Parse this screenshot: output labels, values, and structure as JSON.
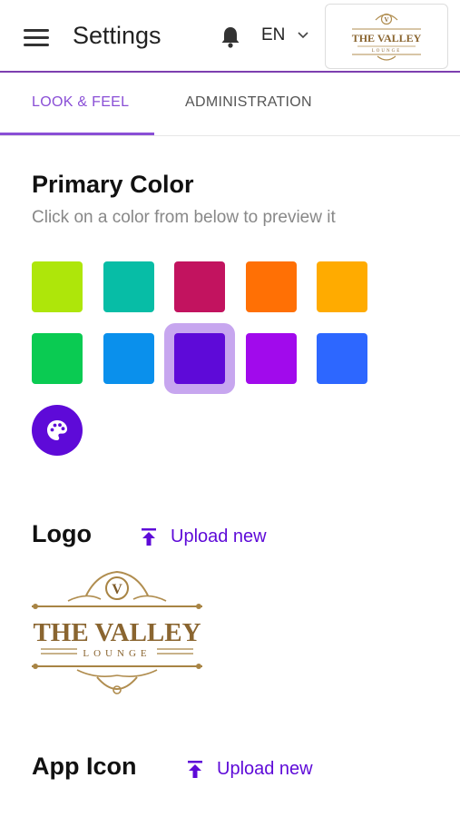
{
  "header": {
    "title": "Settings",
    "language": "EN",
    "logo": {
      "line1": "THE VALLEY",
      "line2": "LOUNGE",
      "monogram": "V"
    }
  },
  "tabs": [
    {
      "label": "LOOK & FEEL",
      "active": true
    },
    {
      "label": "ADMINISTRATION",
      "active": false
    }
  ],
  "primary_color": {
    "title": "Primary Color",
    "subtitle": "Click on a color from below to preview it",
    "swatches": [
      {
        "color": "#aee60a"
      },
      {
        "color": "#07bda6"
      },
      {
        "color": "#c2135f"
      },
      {
        "color": "#ff7005"
      },
      {
        "color": "#ffab00"
      },
      {
        "color": "#0acb52"
      },
      {
        "color": "#0a90ec"
      },
      {
        "color": "#5e0ad8",
        "selected": true
      },
      {
        "color": "#a10aec"
      },
      {
        "color": "#2d67ff"
      }
    ],
    "palette_icon": "palette-icon"
  },
  "logo_section": {
    "title": "Logo",
    "upload_label": "Upload new",
    "logo": {
      "line1": "THE VALLEY",
      "line2": "LOUNGE",
      "monogram": "V"
    }
  },
  "app_icon_section": {
    "title": "App Icon",
    "upload_label": "Upload new"
  },
  "colors": {
    "accent": "#8a4fd6",
    "primary": "#5e0ad8",
    "gold": "#a88444"
  }
}
